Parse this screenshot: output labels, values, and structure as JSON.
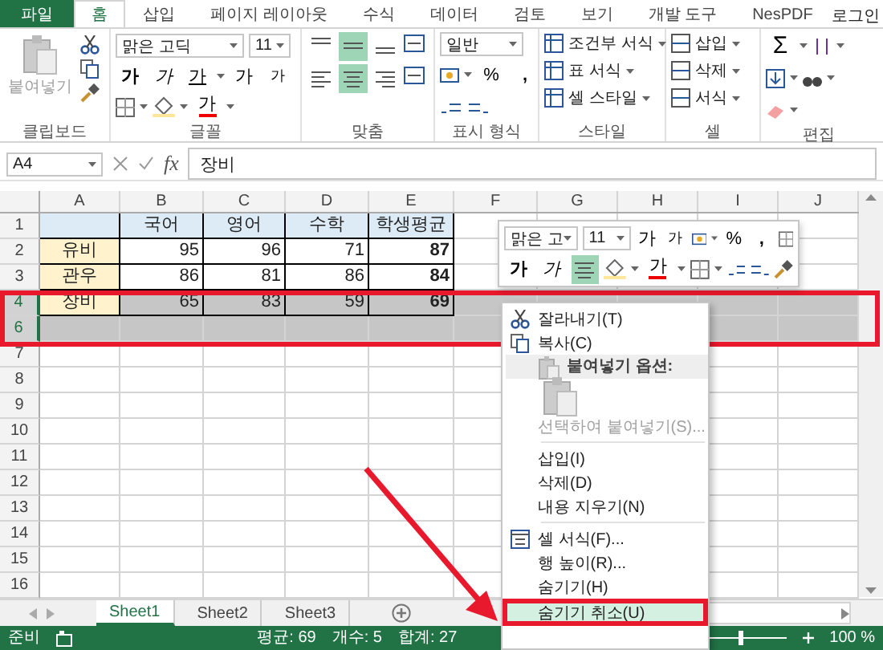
{
  "ribbon_tabs": [
    {
      "label": "파일",
      "kind": "file",
      "selected": false
    },
    {
      "label": "홈",
      "kind": "tab",
      "selected": true
    },
    {
      "label": "삽입",
      "kind": "tab",
      "selected": false
    },
    {
      "label": "페이지 레이아웃",
      "kind": "tab",
      "selected": false
    },
    {
      "label": "수식",
      "kind": "tab",
      "selected": false
    },
    {
      "label": "데이터",
      "kind": "tab",
      "selected": false
    },
    {
      "label": "검토",
      "kind": "tab",
      "selected": false
    },
    {
      "label": "보기",
      "kind": "tab",
      "selected": false
    },
    {
      "label": "개발 도구",
      "kind": "tab",
      "selected": false
    },
    {
      "label": "NesPDF",
      "kind": "tab",
      "selected": false
    }
  ],
  "account": "로그인",
  "clipboard": {
    "label": "클립보드",
    "paste": {
      "label": "붙여넣기",
      "disabled": true
    }
  },
  "font": {
    "label": "글꼴",
    "font_name": "맑은 고딕",
    "font_size": "11",
    "styles": [
      {
        "kind": "bold",
        "label": "가"
      },
      {
        "kind": "italic",
        "label": "가"
      },
      {
        "kind": "underline",
        "label": "가"
      }
    ],
    "grow": "가",
    "shrink": "가",
    "font_color": "가"
  },
  "alignment": {
    "label": "맞춤",
    "buttons": [
      {
        "kind": "top",
        "selected": false
      },
      {
        "kind": "middle",
        "selected": true
      },
      {
        "kind": "bottom",
        "selected": false
      },
      {
        "kind": "left",
        "selected": false
      },
      {
        "kind": "center",
        "selected": true
      },
      {
        "kind": "right",
        "selected": false
      }
    ]
  },
  "number": {
    "label": "표시 형식",
    "format": "일반",
    "percent": "%",
    "comma": ","
  },
  "styles": {
    "label": "스타일",
    "items": [
      "조건부 서식",
      "표 서식",
      "셀 스타일"
    ]
  },
  "cells": {
    "label": "셀",
    "items": [
      "삽입",
      "삭제",
      "서식"
    ]
  },
  "editing": {
    "label": "편집",
    "sum": "Σ"
  },
  "formula_bar": {
    "name_box": "A4",
    "fx": "fx",
    "value": "장비"
  },
  "columns": [
    "A",
    "B",
    "C",
    "D",
    "E",
    "F",
    "G",
    "H",
    "I",
    "J"
  ],
  "rows": [
    {
      "number": "1",
      "kind": "header",
      "selected": false,
      "cells": [
        null,
        "국어",
        "영어",
        "수학",
        "학생평균"
      ]
    },
    {
      "number": "2",
      "kind": "data",
      "selected": false,
      "cells": [
        "유비",
        "95",
        "96",
        "71",
        "87"
      ]
    },
    {
      "number": "3",
      "kind": "data",
      "selected": false,
      "cells": [
        "관우",
        "86",
        "81",
        "86",
        "84"
      ]
    },
    {
      "number": "4",
      "kind": "data",
      "selected": true,
      "cells": [
        "장비",
        "65",
        "83",
        "59",
        "69"
      ]
    },
    {
      "number": "6",
      "kind": "empty",
      "selected": true
    },
    {
      "number": "7",
      "kind": "empty",
      "selected": false
    },
    {
      "number": "8",
      "kind": "empty",
      "selected": false
    },
    {
      "number": "9",
      "kind": "empty",
      "selected": false
    },
    {
      "number": "10",
      "kind": "empty",
      "selected": false
    },
    {
      "number": "11",
      "kind": "empty",
      "selected": false
    },
    {
      "number": "12",
      "kind": "empty",
      "selected": false
    },
    {
      "number": "13",
      "kind": "empty",
      "selected": false
    },
    {
      "number": "14",
      "kind": "empty",
      "selected": false
    },
    {
      "number": "15",
      "kind": "empty",
      "selected": false
    },
    {
      "number": "16",
      "kind": "empty",
      "selected": false
    }
  ],
  "mini_toolbar": {
    "font_name": "맑은 고",
    "font_size": "11",
    "grow": "가",
    "shrink": "가",
    "percent": "%",
    "comma": ",",
    "bold": "가",
    "italic": "가",
    "center_selected": true,
    "font_color": "가"
  },
  "context_menu": [
    {
      "kind": "scissors",
      "label": "잘라내기(T)",
      "disabled": false,
      "selected": false
    },
    {
      "kind": "copy",
      "label": "복사(C)",
      "disabled": false,
      "selected": false
    },
    {
      "kind": "header",
      "label": "붙여넣기 옵션:"
    },
    {
      "kind": "clipboard"
    },
    {
      "kind": "plain",
      "label": "선택하여 붙여넣기(S)...",
      "disabled": true,
      "selected": false
    },
    {
      "kind": "separator"
    },
    {
      "kind": "plain",
      "label": "삽입(I)",
      "disabled": false,
      "selected": false
    },
    {
      "kind": "plain",
      "label": "삭제(D)",
      "disabled": false,
      "selected": false
    },
    {
      "kind": "plain",
      "label": "내용 지우기(N)",
      "disabled": false,
      "selected": false
    },
    {
      "kind": "separator"
    },
    {
      "kind": "format",
      "label": "셀 서식(F)...",
      "disabled": false,
      "selected": false
    },
    {
      "kind": "plain",
      "label": "행 높이(R)...",
      "disabled": false,
      "selected": false
    },
    {
      "kind": "plain",
      "label": "숨기기(H)",
      "disabled": false,
      "selected": false
    },
    {
      "kind": "plain",
      "label": "숨기기 취소(U)",
      "disabled": false,
      "selected": true
    }
  ],
  "sheet_tabs": [
    {
      "label": "Sheet1",
      "selected": true
    },
    {
      "label": "Sheet2",
      "selected": false
    },
    {
      "label": "Sheet3",
      "selected": false
    }
  ],
  "status_bar": {
    "mode": "준비",
    "average": "평균: 69",
    "count": "개수: 5",
    "sum": "합계: 27",
    "zoom_slider": {
      "level": 0.5
    },
    "zoom": "100 %"
  }
}
